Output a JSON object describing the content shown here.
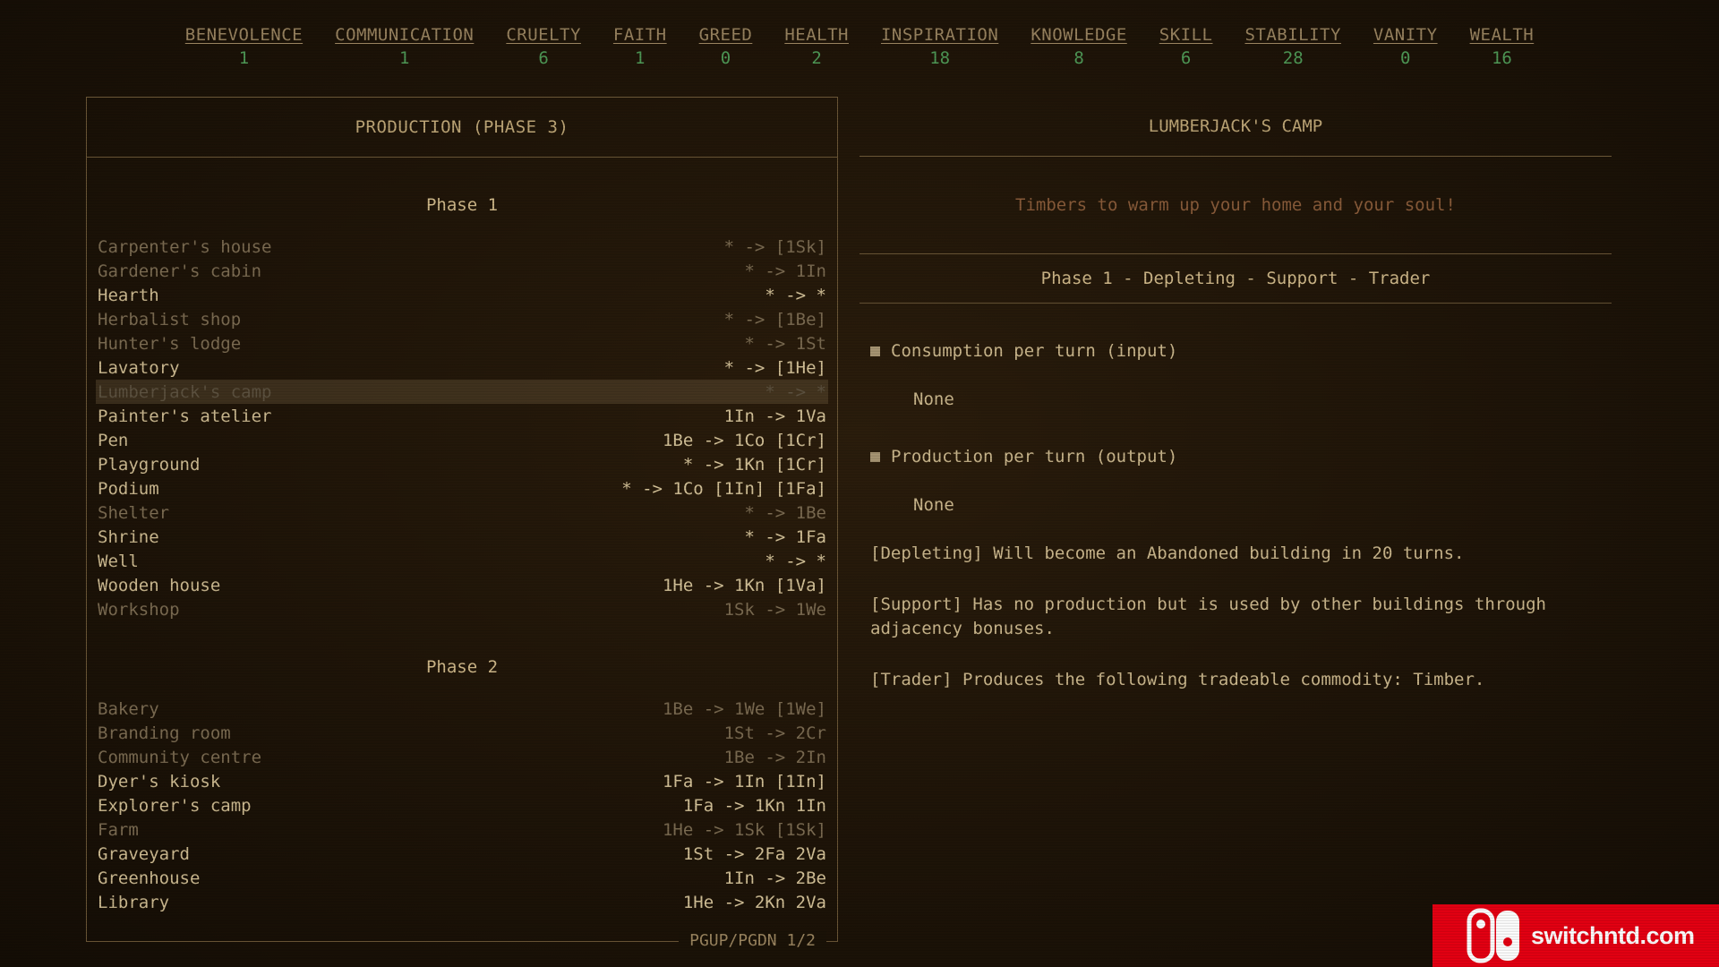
{
  "stats": [
    {
      "name": "BENEVOLENCE",
      "value": "1"
    },
    {
      "name": "COMMUNICATION",
      "value": "1"
    },
    {
      "name": "CRUELTY",
      "value": "6"
    },
    {
      "name": "FAITH",
      "value": "1"
    },
    {
      "name": "GREED",
      "value": "0"
    },
    {
      "name": "HEALTH",
      "value": "2"
    },
    {
      "name": "INSPIRATION",
      "value": "18"
    },
    {
      "name": "KNOWLEDGE",
      "value": "8"
    },
    {
      "name": "SKILL",
      "value": "6"
    },
    {
      "name": "STABILITY",
      "value": "28"
    },
    {
      "name": "VANITY",
      "value": "0"
    },
    {
      "name": "WEALTH",
      "value": "16"
    }
  ],
  "production": {
    "title": "PRODUCTION (PHASE 3)",
    "pager": "PGUP/PGDN 1/2",
    "phase1": {
      "heading": "Phase 1",
      "rows": [
        {
          "name": "Carpenter's house",
          "recipe": "* -> [1Sk]"
        },
        {
          "name": "Gardener's cabin",
          "recipe": "* -> 1In"
        },
        {
          "name": "Hearth",
          "recipe": "* -> *"
        },
        {
          "name": "Herbalist shop",
          "recipe": "* -> [1Be]"
        },
        {
          "name": "Hunter's lodge",
          "recipe": "* -> 1St"
        },
        {
          "name": "Lavatory",
          "recipe": "* -> [1He]"
        },
        {
          "name": "Lumberjack's camp",
          "recipe": "* -> *"
        },
        {
          "name": "Painter's atelier",
          "recipe": "1In -> 1Va"
        },
        {
          "name": "Pen",
          "recipe": "1Be -> 1Co [1Cr]"
        },
        {
          "name": "Playground",
          "recipe": "* -> 1Kn [1Cr]"
        },
        {
          "name": "Podium",
          "recipe": "* -> 1Co [1In] [1Fa]"
        },
        {
          "name": "Shelter",
          "recipe": "* -> 1Be"
        },
        {
          "name": "Shrine",
          "recipe": "* -> 1Fa"
        },
        {
          "name": "Well",
          "recipe": "* -> *"
        },
        {
          "name": "Wooden house",
          "recipe": "1He -> 1Kn [1Va]"
        },
        {
          "name": "Workshop",
          "recipe": "1Sk -> 1We"
        }
      ]
    },
    "phase2": {
      "heading": "Phase 2",
      "rows": [
        {
          "name": "Bakery",
          "recipe": "1Be -> 1We [1We]"
        },
        {
          "name": "Branding room",
          "recipe": "1St -> 2Cr"
        },
        {
          "name": "Community centre",
          "recipe": "1Be -> 2In"
        },
        {
          "name": "Dyer's kiosk",
          "recipe": "1Fa -> 1In [1In]"
        },
        {
          "name": "Explorer's camp",
          "recipe": "1Fa -> 1Kn 1In"
        },
        {
          "name": "Farm",
          "recipe": "1He -> 1Sk [1Sk]"
        },
        {
          "name": "Graveyard",
          "recipe": "1St -> 2Fa 2Va"
        },
        {
          "name": "Greenhouse",
          "recipe": "1In -> 2Be"
        },
        {
          "name": "Library",
          "recipe": "1He -> 2Kn 2Va"
        }
      ]
    }
  },
  "detail": {
    "title": "LUMBERJACK'S CAMP",
    "flavor": "Timbers to warm up your home and your soul!",
    "tags": "Phase 1 - Depleting - Support - Trader",
    "consumption_label": "Consumption per turn (input)",
    "consumption_value": "None",
    "production_label": "Production per turn (output)",
    "production_value": "None",
    "depleting": "[Depleting] Will become an Abandoned building in 20 turns.",
    "support": "[Support] Has no production but is used by other buildings through adjacency bonuses.",
    "trader": "[Trader] Produces the following tradeable commodity: Timber."
  },
  "watermark": {
    "text": "switchntd.com"
  }
}
